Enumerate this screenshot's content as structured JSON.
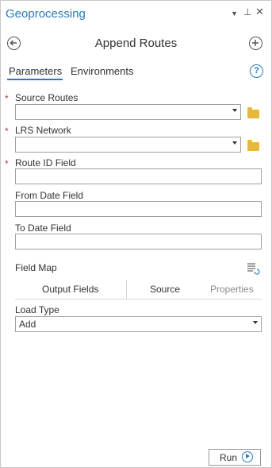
{
  "pane": {
    "title": "Geoprocessing",
    "menu_icon": "chevron-down-icon",
    "pin_icon": "pin-icon",
    "close_icon": "close-icon",
    "menu_glyph": "▼",
    "pin_glyph": "⊥",
    "close_glyph": "✕"
  },
  "tool": {
    "title": "Append Routes",
    "back_icon": "back-arrow-icon",
    "add_icon": "add-icon"
  },
  "tabs": {
    "parameters": "Parameters",
    "environments": "Environments",
    "help_glyph": "?"
  },
  "params": {
    "required_marker": "*",
    "source_routes": {
      "label": "Source Routes",
      "value": ""
    },
    "lrs_network": {
      "label": "LRS Network",
      "value": ""
    },
    "route_id_field": {
      "label": "Route ID Field",
      "value": ""
    },
    "from_date_field": {
      "label": "From Date Field",
      "value": ""
    },
    "to_date_field": {
      "label": "To Date Field",
      "value": ""
    }
  },
  "field_map": {
    "label": "Field Map",
    "tabs": [
      "Output Fields",
      "Source",
      "Properties"
    ]
  },
  "load_type": {
    "label": "Load Type",
    "value": "Add"
  },
  "footer": {
    "run_label": "Run"
  },
  "colors": {
    "accent": "#2a7ab8",
    "required": "#c0392b",
    "folder": "#e8b83a"
  }
}
